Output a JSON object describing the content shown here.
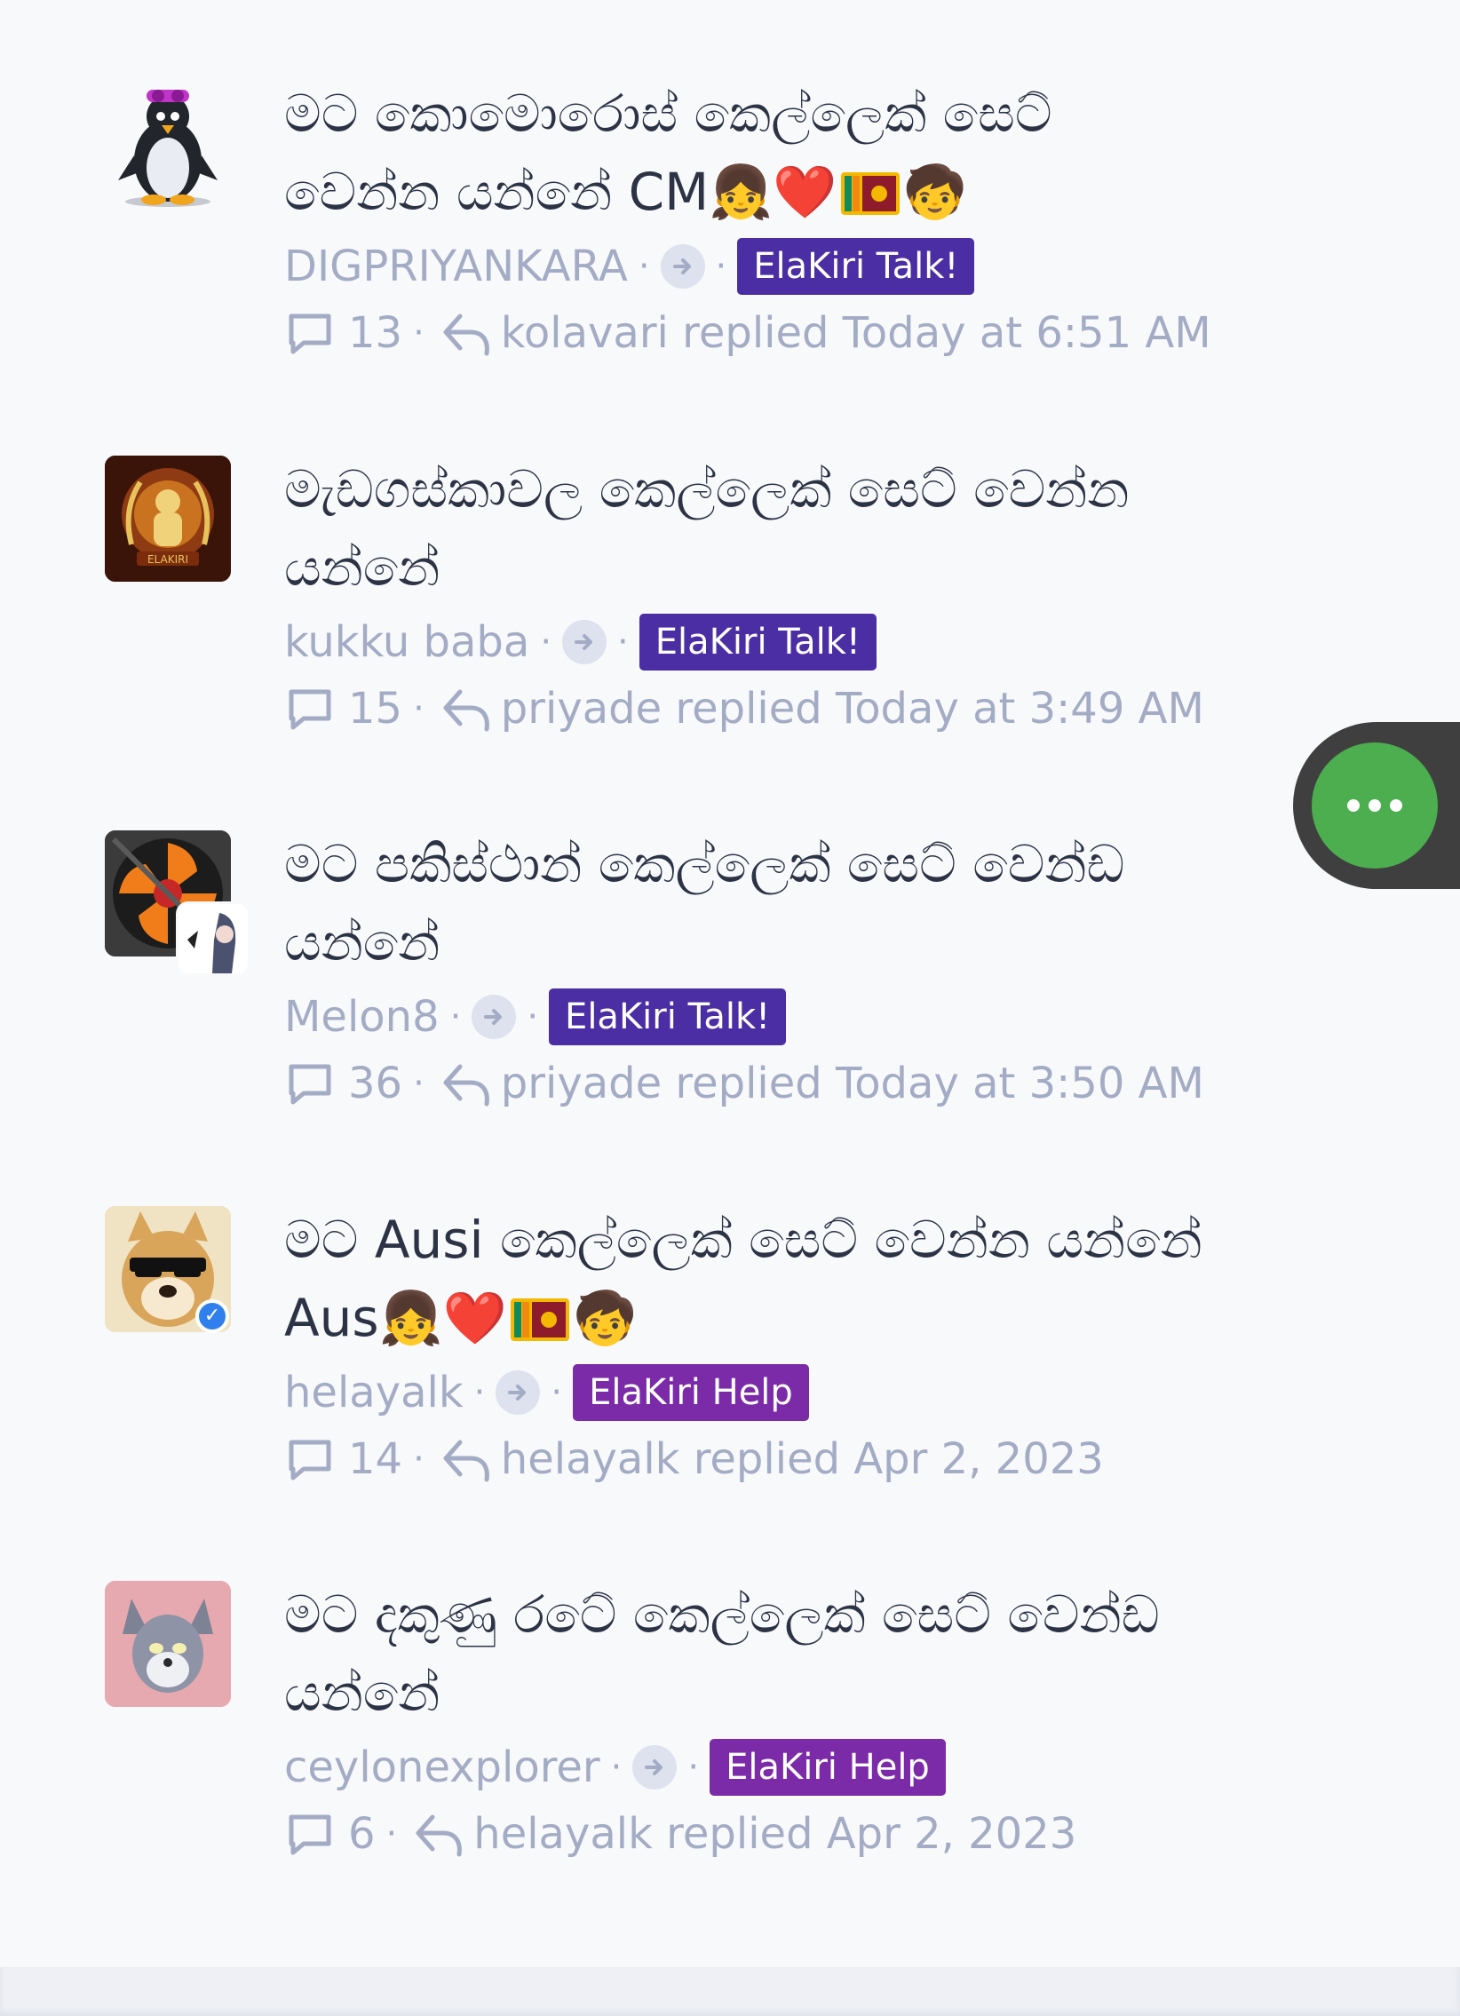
{
  "threads": [
    {
      "title": "මට කොමොරොස් කෙල්ලෙක් සෙට් වෙන්න යන්නේ CM👧❤️🇱🇰🧒",
      "title_lines": [
        "මට කොමොරොස් කෙල්ලෙක් සෙට්",
        "වෙන්න යන්නේ CM👧❤️"
      ],
      "title_tail": "🧒",
      "author": "DIGPRIYANKARA",
      "forum": "ElaKiri Talk!",
      "forum_color": "#4b2ea3",
      "replies": "13",
      "last_reply": "kolavari replied Today at 6:51 AM",
      "avatar_icon": "penguin-avatar-icon"
    },
    {
      "title": "මැඩගස්කාවල කෙල්ලෙක් සෙට් වෙන්න යන්නේ",
      "title_lines": [
        "මැඩගස්කාවල කෙල්ලෙක් සෙට් වෙන්න",
        "යන්නේ"
      ],
      "author": "kukku baba",
      "forum": "ElaKiri Talk!",
      "forum_color": "#4b2ea3",
      "replies": "15",
      "last_reply": "priyade replied Today at 3:49 AM",
      "avatar_icon": "elakiri-logo-avatar-icon"
    },
    {
      "title": "මට පකිස්ථාන් කෙල්ලෙක් සෙට් වෙන්ඩ යන්නේ",
      "title_lines": [
        "මට පකිස්ථාන් කෙල්ලෙක් සෙට් වෙන්ඩ",
        "යන්නේ"
      ],
      "author": "Melon8",
      "forum": "ElaKiri Talk!",
      "forum_color": "#4b2ea3",
      "replies": "36",
      "last_reply": "priyade replied Today at 3:50 AM",
      "avatar_icon": "fan-avatar-icon"
    },
    {
      "title": "මට Ausi කෙල්ලෙක් සෙට් වෙන්න යන්නේ Aus👧❤️🇱🇰🧒",
      "title_lines": [
        "මට Ausi කෙල්ලෙක් සෙට් වෙන්න යන්නේ",
        "Aus👧❤️"
      ],
      "title_tail": "🧒",
      "author": "helayalk",
      "forum": "ElaKiri Help",
      "forum_color": "#7b2ba8",
      "replies": "14",
      "last_reply": "helayalk replied Apr 2, 2023",
      "avatar_icon": "doge-avatar-icon"
    },
    {
      "title": "මට දකුණු රටේ කෙල්ලෙක් සෙට් වෙන්ඩ යන්නේ",
      "title_lines": [
        "මට දකුණු රටේ කෙල්ලෙක් සෙට් වෙන්ඩ",
        "යන්නේ"
      ],
      "author": "ceylonexplorer",
      "forum": "ElaKiri Help",
      "forum_color": "#7b2ba8",
      "replies": "6",
      "last_reply": "helayalk replied Apr 2, 2023",
      "avatar_icon": "cat-avatar-icon"
    }
  ],
  "icons": {
    "comment": "comment-icon",
    "reply": "reply-icon",
    "arrow": "arrow-right-icon",
    "fab": "more-options-icon"
  },
  "colors": {
    "title": "#2b3345",
    "meta": "#a3acc4",
    "fab": "#4cae4f"
  }
}
